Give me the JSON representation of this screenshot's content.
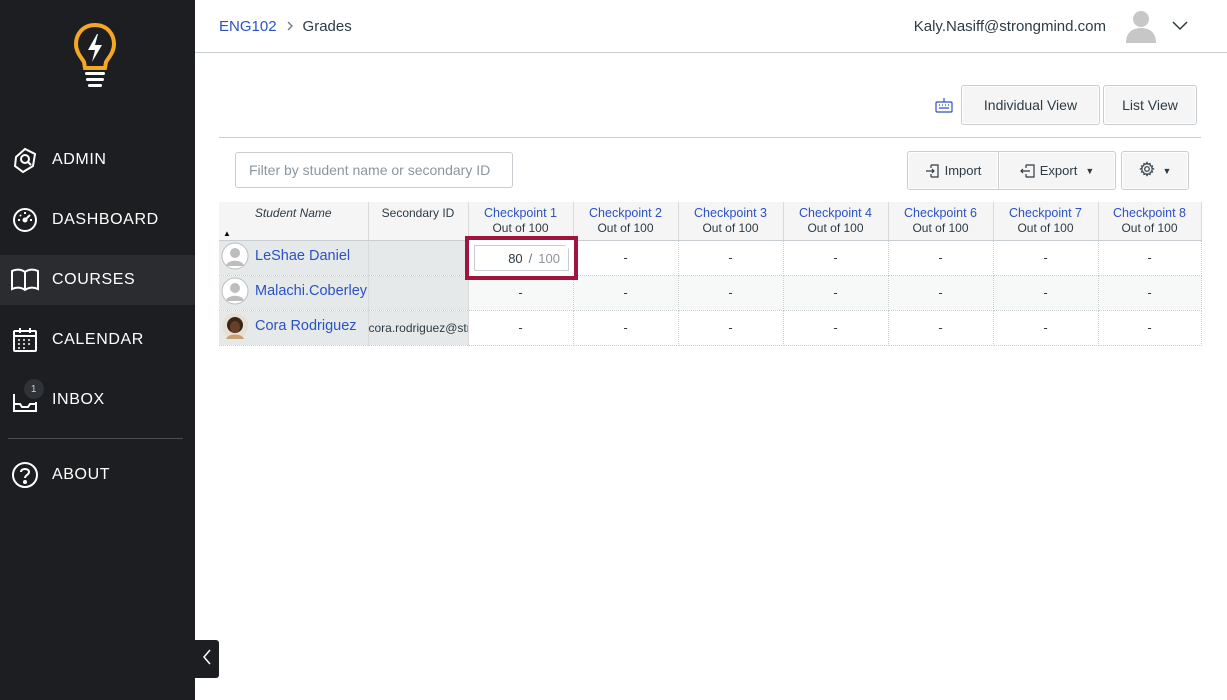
{
  "sidebar": {
    "items": [
      {
        "label": "ADMIN",
        "icon": "shield-icon"
      },
      {
        "label": "DASHBOARD",
        "icon": "gauge-icon"
      },
      {
        "label": "COURSES",
        "icon": "book-icon",
        "active": true
      },
      {
        "label": "CALENDAR",
        "icon": "calendar-icon"
      },
      {
        "label": "INBOX",
        "icon": "inbox-icon",
        "badge": "1"
      },
      {
        "label": "ABOUT",
        "icon": "question-icon"
      }
    ]
  },
  "header": {
    "breadcrumb_course": "ENG102",
    "breadcrumb_current": "Grades",
    "user_email": "Kaly.Nasiff@strongmind.com"
  },
  "toolbar": {
    "individual_view": "Individual View",
    "list_view": "List View",
    "filter_placeholder": "Filter by student name or secondary ID",
    "import_label": "Import",
    "export_label": "Export"
  },
  "grid": {
    "headers": {
      "student_name": "Student Name",
      "secondary_id": "Secondary ID"
    },
    "assignments": [
      {
        "title": "Checkpoint 1",
        "sub": "Out of 100"
      },
      {
        "title": "Checkpoint 2",
        "sub": "Out of 100"
      },
      {
        "title": "Checkpoint 3",
        "sub": "Out of 100"
      },
      {
        "title": "Checkpoint 4",
        "sub": "Out of 100"
      },
      {
        "title": "Checkpoint 6",
        "sub": "Out of 100"
      },
      {
        "title": "Checkpoint 7",
        "sub": "Out of 100"
      },
      {
        "title": "Checkpoint 8",
        "sub": "Out of 100"
      }
    ],
    "students": [
      {
        "name": "LeShae Daniel",
        "secondary_id": "",
        "grades": [
          "80",
          "-",
          "-",
          "-",
          "-",
          "-",
          "-"
        ]
      },
      {
        "name": "Malachi.Coberley",
        "secondary_id": "",
        "grades": [
          "-",
          "-",
          "-",
          "-",
          "-",
          "-",
          "-"
        ]
      },
      {
        "name": "Cora Rodriguez",
        "secondary_id": "cora.rodriguez@strongmind.com",
        "grades": [
          "-",
          "-",
          "-",
          "-",
          "-",
          "-",
          "-"
        ]
      }
    ],
    "active_cell": {
      "score": "80",
      "separator": "/",
      "max": "100"
    }
  },
  "colors": {
    "sidebar_bg": "#1c1e21",
    "link": "#2b52c4",
    "logo_orange": "#f5a623",
    "active_cell_border": "#a0153e"
  }
}
